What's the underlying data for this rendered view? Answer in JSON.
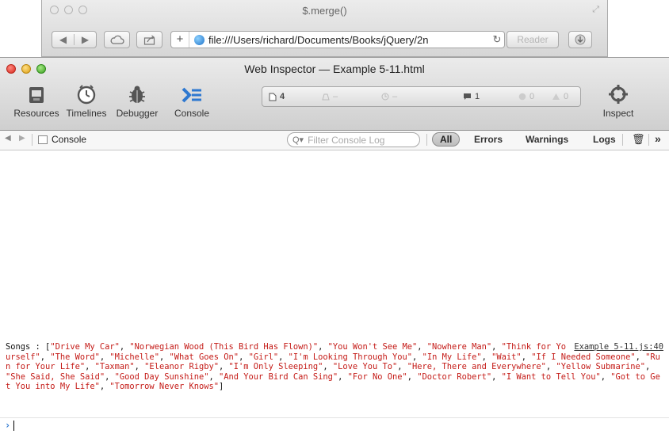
{
  "browser": {
    "title": "$.merge()",
    "url": "file:///Users/richard/Documents/Books/jQuery/2n",
    "reader_label": "Reader",
    "nav_back_glyph": "◀",
    "nav_forward_glyph": "▶",
    "new_tab_glyph": "+",
    "reload_glyph": "↻"
  },
  "inspector": {
    "title": "Web Inspector — Example 5-11.html",
    "toolbar": {
      "resources_label": "Resources",
      "timelines_label": "Timelines",
      "debugger_label": "Debugger",
      "console_label": "Console",
      "inspect_label": "Inspect"
    },
    "activity": {
      "resources_count": "4",
      "requests_count": "–",
      "time_value": "–",
      "logs_count": "1",
      "errors_count": "0",
      "warnings_count": "0"
    },
    "header": {
      "breadcrumb": "Console",
      "filter_placeholder": "Filter Console Log",
      "scope_all": "All",
      "scope_errors": "Errors",
      "scope_warnings": "Warnings",
      "scope_logs": "Logs"
    },
    "console": {
      "log_label": "Songs : [",
      "log_close": "]",
      "source": "Example 5-11.js:40",
      "songs": [
        "Drive My Car",
        "Norwegian Wood (This Bird Has Flown)",
        "You Won't See Me",
        "Nowhere Man",
        "Think for Yourself",
        "The Word",
        "Michelle",
        "What Goes On",
        "Girl",
        "I'm Looking Through You",
        "In My Life",
        "Wait",
        "If I Needed Someone",
        "Run for Your Life",
        "Taxman",
        "Eleanor Rigby",
        "I'm Only Sleeping",
        "Love You To",
        "Here, There and Everywhere",
        "Yellow Submarine",
        "She Said, She Said",
        "Good Day Sunshine",
        "And Your Bird Can Sing",
        "For No One",
        "Doctor Robert",
        "I Want to Tell You",
        "Got to Get You into My Life",
        "Tomorrow Never Knows"
      ],
      "prompt_glyph": "›"
    }
  },
  "colors": {
    "string_red": "#c41a16",
    "console_blue": "#2e78d0"
  }
}
